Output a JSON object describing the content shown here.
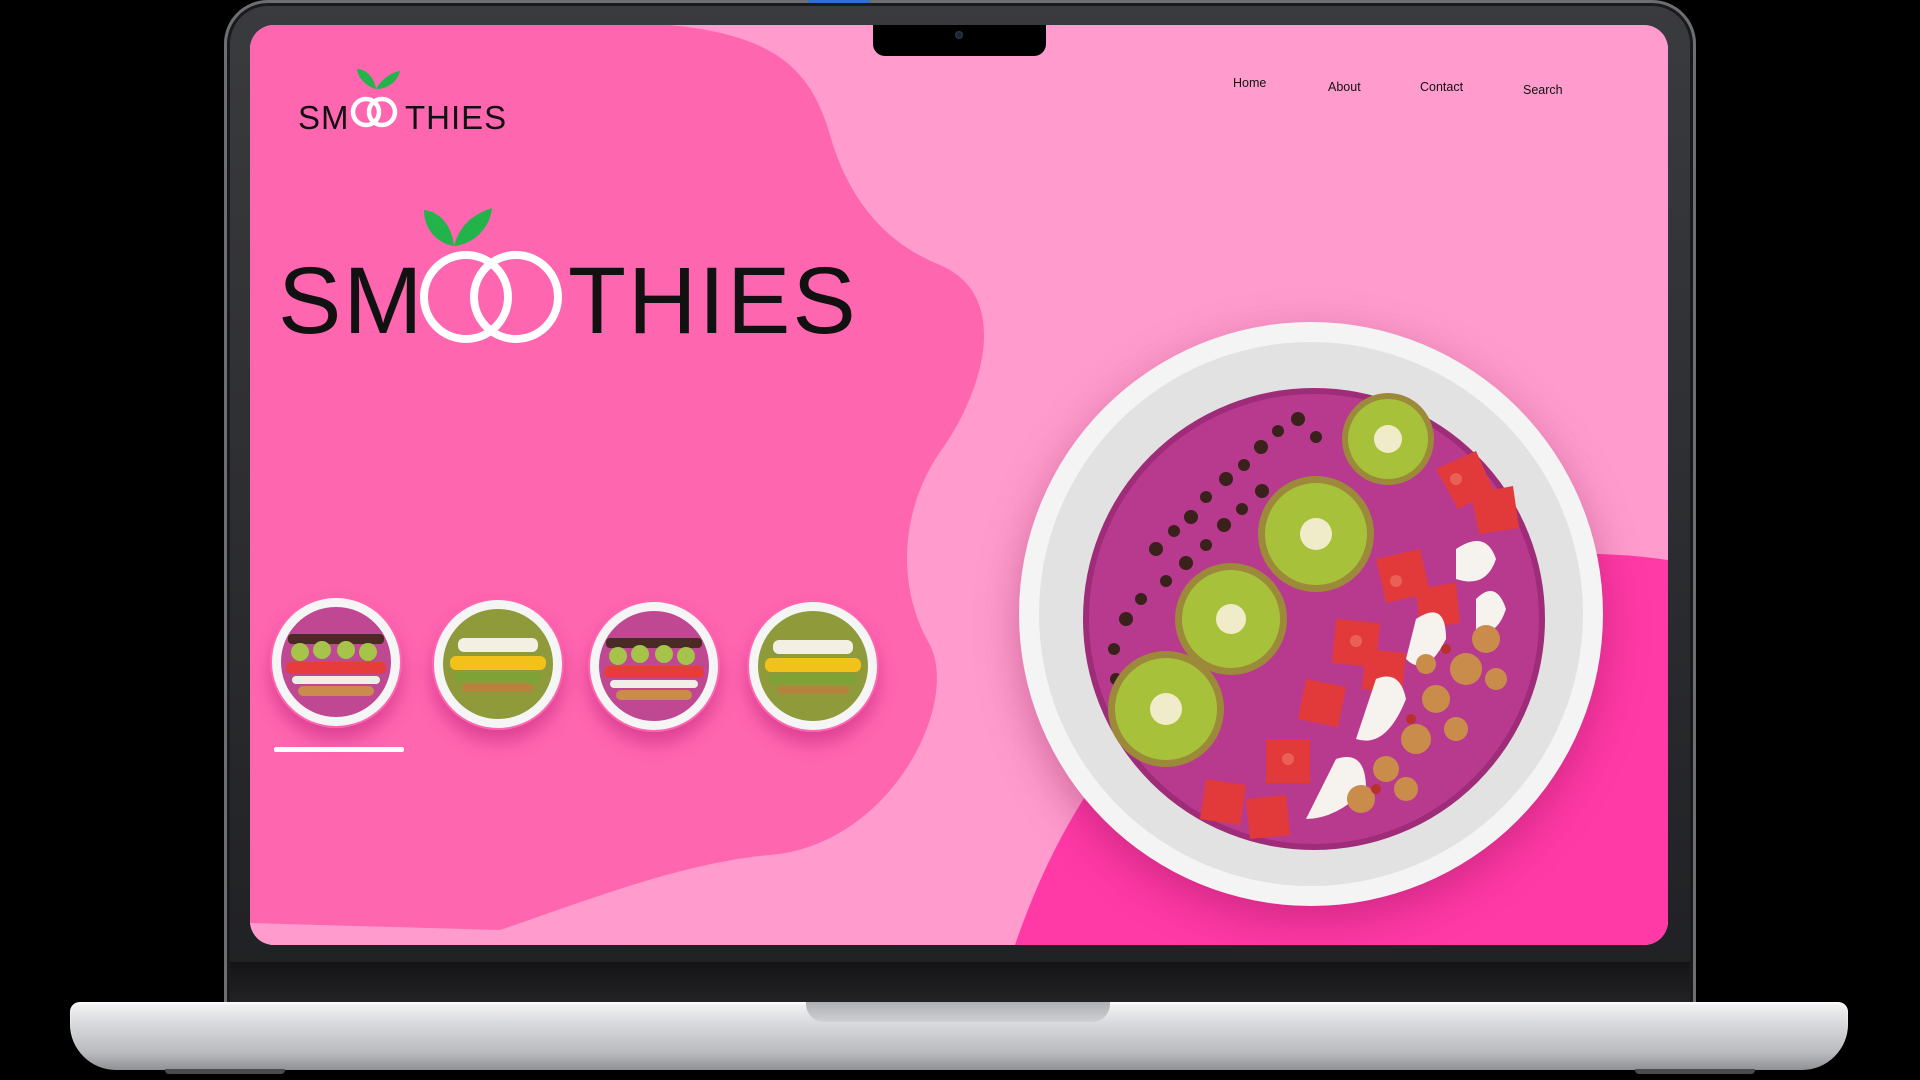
{
  "site": {
    "brand": {
      "logo_text": "SMOOTHIES",
      "logo_text_left": "SM",
      "logo_text_right": "THIES"
    },
    "nav": {
      "items": [
        {
          "label": "Home"
        },
        {
          "label": "About"
        },
        {
          "label": "Contact"
        },
        {
          "label": "Search"
        }
      ]
    },
    "gallery": {
      "thumbnails": [
        {
          "flavor": "berry-kiwi",
          "selected": true
        },
        {
          "flavor": "green-mango",
          "selected": false
        },
        {
          "flavor": "berry-kiwi",
          "selected": false
        },
        {
          "flavor": "green-mango",
          "selected": false
        }
      ]
    },
    "hero": {
      "image": "pink smoothie bowl with kiwi, strawberries, cacao nibs, coconut flakes and granola"
    }
  },
  "colors": {
    "background_light_pink": "#ff9ccd",
    "blob_pink": "#ff66b0",
    "hot_pink": "#ff39a6",
    "leaf_green": "#22b34a",
    "text_dark": "#111111",
    "smoothie_berry": "#b83a8e",
    "smoothie_green": "#8f9a3a"
  },
  "icons": [
    "leaf-logo-icon",
    "ring-logo-icon",
    "camera-icon"
  ]
}
